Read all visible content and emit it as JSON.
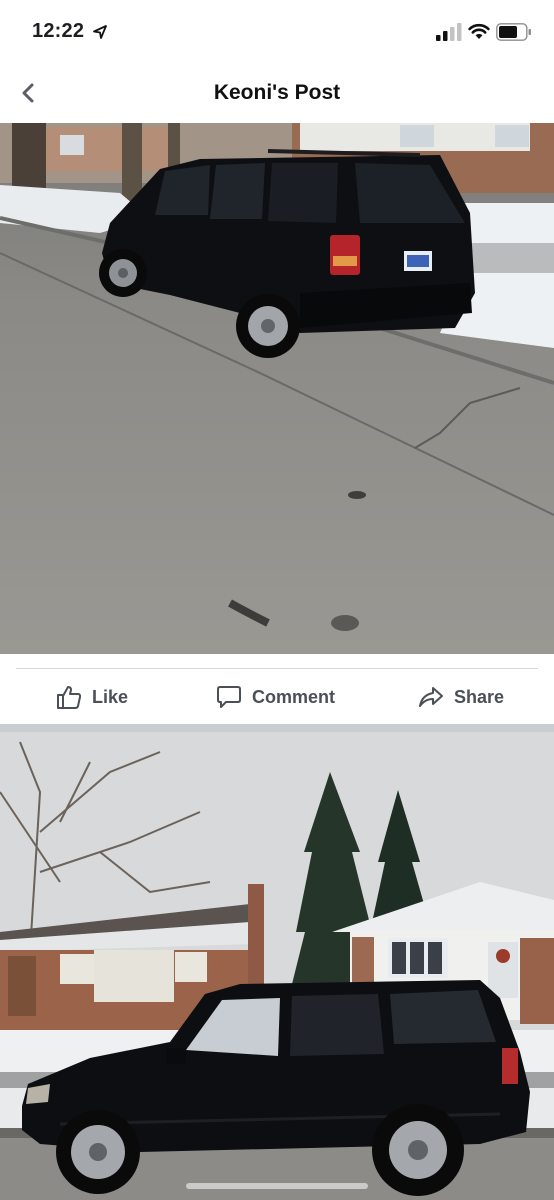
{
  "status_bar": {
    "time": "12:22",
    "icons": [
      "location-arrow-icon",
      "cellular-signal-icon",
      "wifi-icon",
      "battery-icon"
    ]
  },
  "header": {
    "title": "Keoni's Post",
    "back_icon": "chevron-left-icon"
  },
  "actions": {
    "like_label": "Like",
    "comment_label": "Comment",
    "share_label": "Share"
  },
  "colors": {
    "text_primary": "#111111",
    "action_text": "#4b4f56",
    "divider": "#d5d7db",
    "separator_band": "#c9ccd1",
    "car_body": "#0d0e12"
  }
}
